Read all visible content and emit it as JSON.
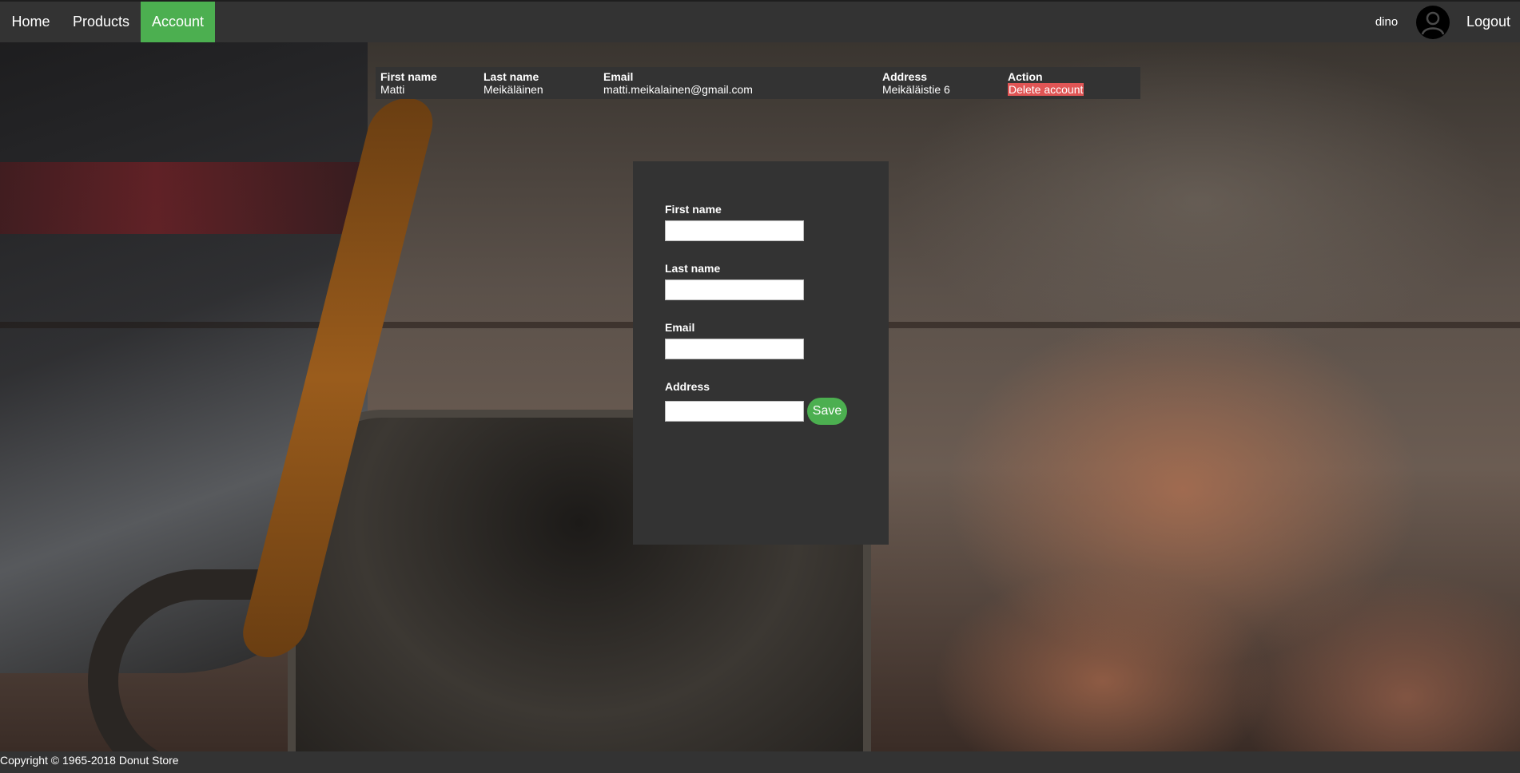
{
  "nav": {
    "home": "Home",
    "products": "Products",
    "account": "Account",
    "username": "dino",
    "logout": "Logout",
    "avatar_icon": "user-avatar-icon",
    "active_color": "#4caf50"
  },
  "account_table": {
    "headers": [
      "First name",
      "Last name",
      "Email",
      "Address",
      "Action"
    ],
    "row": {
      "first_name": "Matti",
      "last_name": "Meikäläinen",
      "email": "matti.meikalainen@gmail.com",
      "address": "Meikäläistie 6",
      "action": "Delete account"
    },
    "action_color": "#e05555"
  },
  "form": {
    "first_name_label": "First name",
    "first_name_value": "",
    "last_name_label": "Last name",
    "last_name_value": "",
    "email_label": "Email",
    "email_value": "",
    "address_label": "Address",
    "address_value": "",
    "save_label": "Save"
  },
  "footer": {
    "copyright": "Copyright © 1965-2018 Donut Store"
  }
}
